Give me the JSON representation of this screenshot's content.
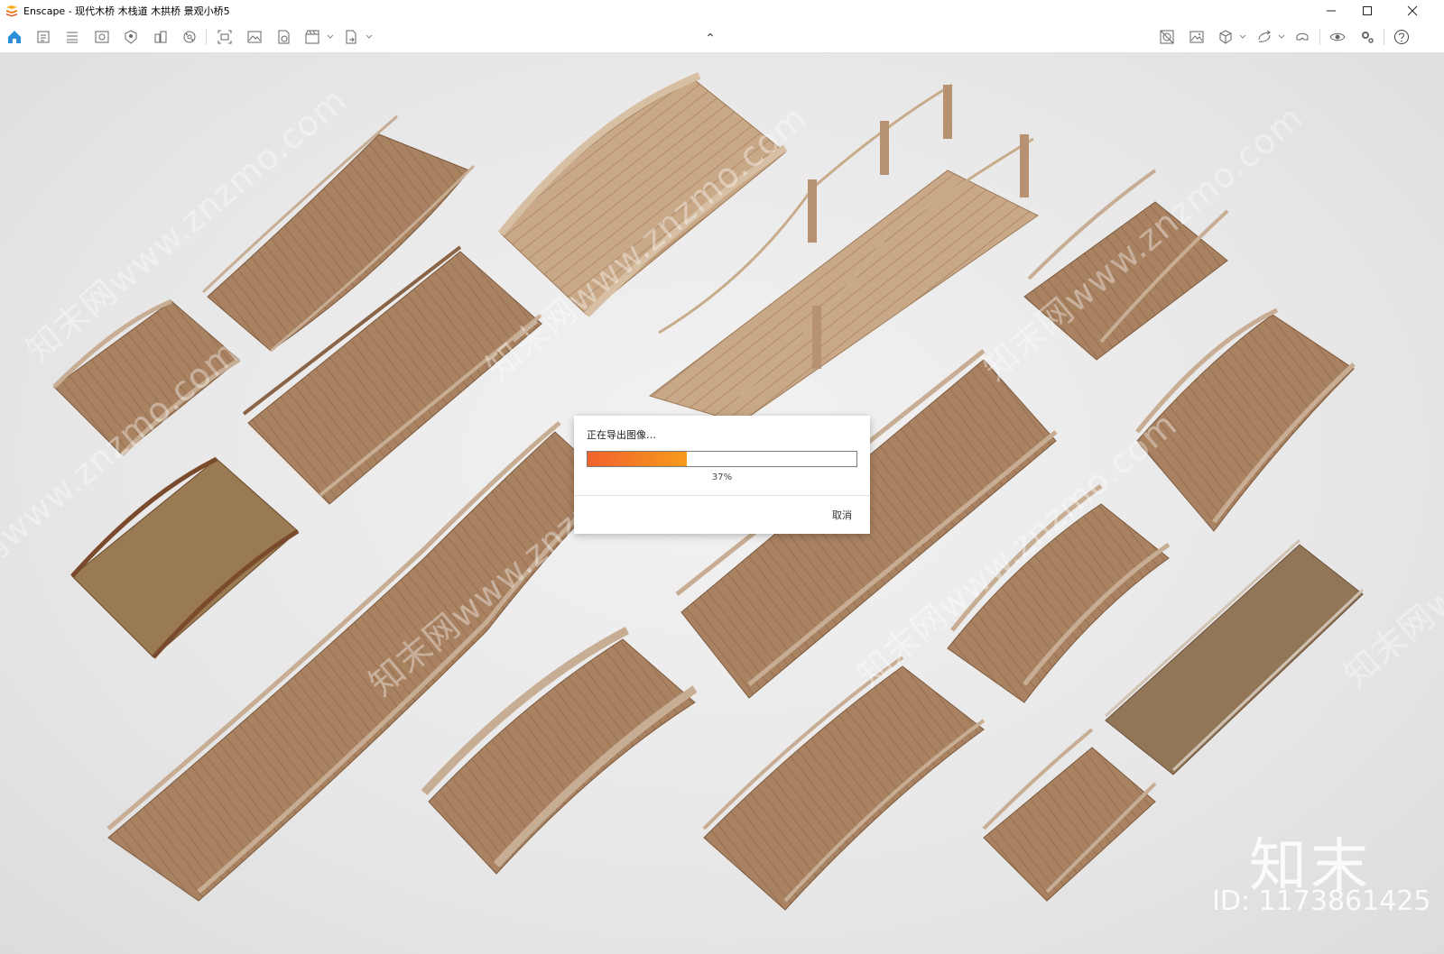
{
  "window": {
    "title": "Enscape - 现代木桥 木栈道 木拱桥 景观小桥5",
    "controls": [
      "minimize",
      "maximize",
      "close"
    ]
  },
  "toolbar": {
    "left_icons": [
      "home-icon",
      "asset-library-icon",
      "material-editor-icon",
      "view-management-icon",
      "visual-settings-icon",
      "site-context-icon",
      "atmosphere-icon",
      "screenshot-icon",
      "render-image-icon",
      "batch-render-icon",
      "video-editor-icon",
      "export-icon"
    ],
    "right_icons": [
      "panorama-icon",
      "image-icon",
      "cube-icon",
      "sync-icon",
      "headset-icon",
      "eye-icon",
      "settings-icon",
      "help-icon"
    ],
    "collapse_glyph": "⌃"
  },
  "dialog": {
    "message": "正在导出图像…",
    "progress": 0.37,
    "percent_label": "37%",
    "cancel_label": "取消",
    "accent_start": "#f2622d",
    "accent_end": "#f79a1c"
  },
  "watermark": {
    "brand": "知末",
    "id_label": "ID: 1173861425",
    "diagonal_text": "知末网www.znzmo.com"
  }
}
